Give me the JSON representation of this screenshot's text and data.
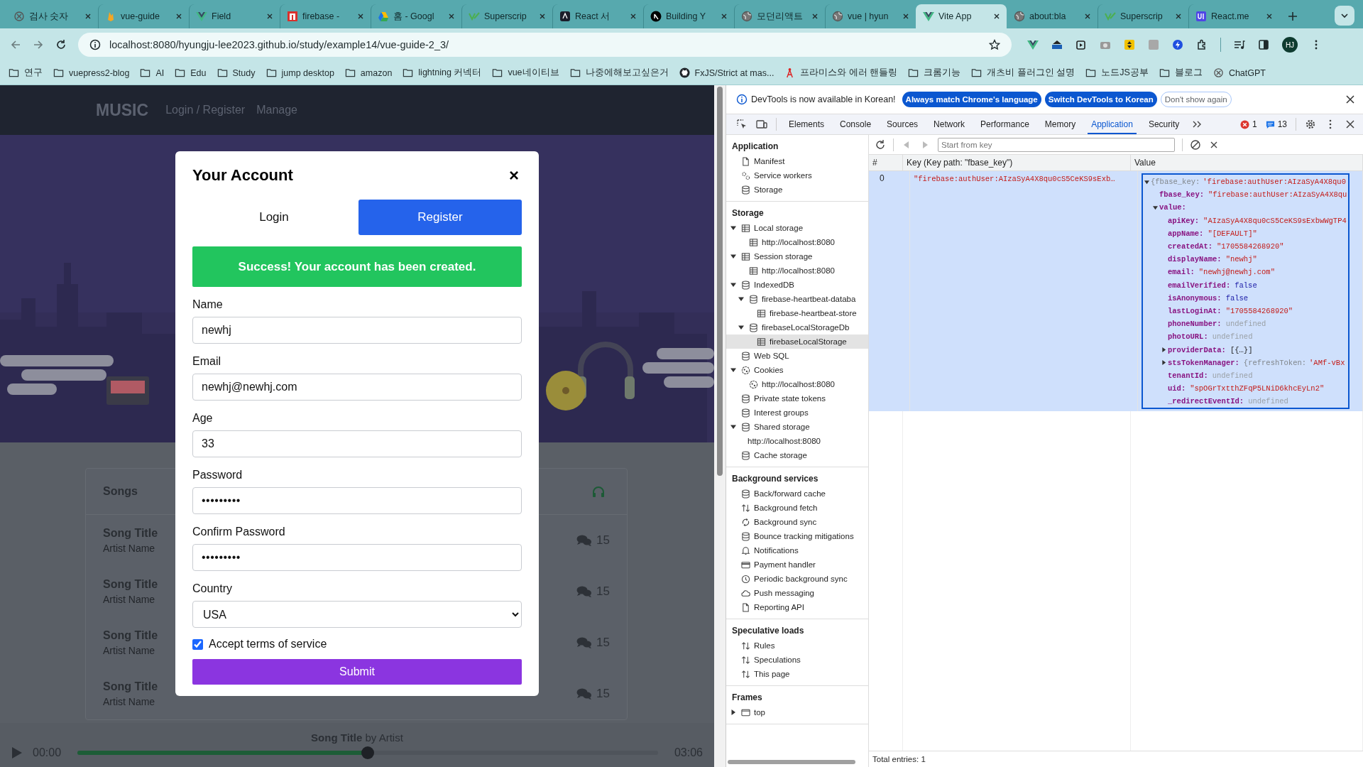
{
  "browser": {
    "tabs": [
      {
        "title": "검사 숫자",
        "kind": "knot",
        "selected": false
      },
      {
        "title": "vue-guide",
        "kind": "flame",
        "selected": false
      },
      {
        "title": "Field",
        "kind": "vue",
        "selected": false
      },
      {
        "title": "firebase -",
        "kind": "red",
        "selected": false
      },
      {
        "title": "홈 - Googl",
        "kind": "drive",
        "selected": false
      },
      {
        "title": "Superscrip",
        "kind": "vite",
        "selected": false
      },
      {
        "title": "React 서",
        "kind": "dark",
        "selected": false
      },
      {
        "title": "Building Y",
        "kind": "next",
        "selected": false
      },
      {
        "title": "모던리액트",
        "kind": "globe",
        "selected": false
      },
      {
        "title": "vue | hyun",
        "kind": "globe",
        "selected": false
      },
      {
        "title": "Vite App",
        "kind": "vue",
        "selected": true
      },
      {
        "title": "about:bla",
        "kind": "globe",
        "selected": false
      },
      {
        "title": "Superscrip",
        "kind": "vite",
        "selected": false
      },
      {
        "title": "React.me",
        "kind": "ui",
        "selected": false
      }
    ],
    "address": "localhost:8080/hyungju-lee2023.github.io/study/example14/vue-guide-2_3/",
    "profile": "HJ",
    "bookmarks": [
      {
        "label": "연구",
        "kind": "folder"
      },
      {
        "label": "vuepress2-blog",
        "kind": "folder"
      },
      {
        "label": "AI",
        "kind": "folder"
      },
      {
        "label": "Edu",
        "kind": "folder"
      },
      {
        "label": "Study",
        "kind": "folder"
      },
      {
        "label": "jump desktop",
        "kind": "folder"
      },
      {
        "label": "amazon",
        "kind": "folder"
      },
      {
        "label": "lightning 커넥터",
        "kind": "folder"
      },
      {
        "label": "vue네이티브",
        "kind": "folder"
      },
      {
        "label": "나중에해보고싶은거",
        "kind": "folder"
      },
      {
        "label": "FxJS/Strict at mas...",
        "kind": "cat"
      },
      {
        "label": "프라미스와 에러 핸들링",
        "kind": "antenna"
      },
      {
        "label": "크롬기능",
        "kind": "folder"
      },
      {
        "label": "개츠비 플러그인 설명",
        "kind": "folder"
      },
      {
        "label": "노드JS공부",
        "kind": "folder"
      },
      {
        "label": "블로그",
        "kind": "folder"
      },
      {
        "label": "ChatGPT",
        "kind": "knot"
      }
    ]
  },
  "page": {
    "logo": "MUSIC",
    "nav": [
      "Login / Register",
      "Manage"
    ],
    "songs": {
      "title": "Songs",
      "rows": [
        {
          "title": "Song Title",
          "artist": "Artist Name",
          "comments": "15"
        },
        {
          "title": "Song Title",
          "artist": "Artist Name",
          "comments": "15"
        },
        {
          "title": "Song Title",
          "artist": "Artist Name",
          "comments": "15"
        },
        {
          "title": "Song Title",
          "artist": "Artist Name",
          "comments": "15"
        }
      ]
    },
    "player": {
      "now_playing": "**Song Title** by Artist",
      "elapsed": "00:00",
      "duration": "03:06",
      "level": 0.5
    },
    "modal": {
      "title": "Your Account",
      "close": "×",
      "tabs": [
        {
          "label": "Login",
          "selected": false
        },
        {
          "label": "Register",
          "selected": true
        }
      ],
      "alert": "Success! Your account has been created.",
      "fields": [
        {
          "label": "Name",
          "value": "newhj",
          "kind": "text"
        },
        {
          "label": "Email",
          "value": "newhj@newhj.com",
          "kind": "text"
        },
        {
          "label": "Age",
          "value": "33",
          "kind": "text"
        },
        {
          "label": "Password",
          "value": "•••••••••",
          "kind": "password"
        },
        {
          "label": "Confirm Password",
          "value": "•••••••••",
          "kind": "password"
        },
        {
          "label": "Country",
          "value": "USA",
          "kind": "select"
        }
      ],
      "terms": {
        "label": "Accept terms of service",
        "checked": true
      },
      "submit": "Submit"
    }
  },
  "devtools": {
    "notice": {
      "text": "DevTools is now available in Korean!",
      "buttons": [
        {
          "label": "Always match Chrome's language",
          "kind": "primary"
        },
        {
          "label": "Switch DevTools to Korean",
          "kind": "primary"
        },
        {
          "label": "Don't show again",
          "kind": "outline"
        }
      ]
    },
    "tabs": [
      {
        "label": "Elements",
        "selected": false
      },
      {
        "label": "Console",
        "selected": false
      },
      {
        "label": "Sources",
        "selected": false
      },
      {
        "label": "Network",
        "selected": false
      },
      {
        "label": "Performance",
        "selected": false
      },
      {
        "label": "Memory",
        "selected": false
      },
      {
        "label": "Application",
        "selected": true
      },
      {
        "label": "Security",
        "selected": false
      }
    ],
    "errors": "1",
    "messages": "13",
    "sidebar": [
      {
        "heading": "Application",
        "items": [
          {
            "label": "Manifest",
            "kind": "file",
            "selected": false
          },
          {
            "label": "Service workers",
            "kind": "gears",
            "selected": false
          },
          {
            "label": "Storage",
            "kind": "database",
            "selected": false
          }
        ]
      },
      {
        "heading": "Storage",
        "items": [
          {
            "label": "Local storage",
            "kind": "table",
            "selected": false,
            "expanded": true,
            "children": [
              {
                "label": "http://localhost:8080",
                "kind": "table",
                "selected": false
              }
            ]
          },
          {
            "label": "Session storage",
            "kind": "table",
            "selected": false,
            "expanded": true,
            "children": [
              {
                "label": "http://localhost:8080",
                "kind": "table",
                "selected": false
              }
            ]
          },
          {
            "label": "IndexedDB",
            "kind": "database",
            "selected": false,
            "expanded": true,
            "children": [
              {
                "label": "firebase-heartbeat-databa",
                "kind": "database",
                "selected": false,
                "expanded": true,
                "children": [
                  {
                    "label": "firebase-heartbeat-store",
                    "kind": "table",
                    "selected": false
                  }
                ]
              },
              {
                "label": "firebaseLocalStorageDb",
                "kind": "database",
                "selected": false,
                "expanded": true,
                "children": [
                  {
                    "label": "firebaseLocalStorage",
                    "kind": "table",
                    "selected": true
                  }
                ]
              }
            ]
          },
          {
            "label": "Web SQL",
            "kind": "database",
            "selected": false
          },
          {
            "label": "Cookies",
            "kind": "cookie",
            "selected": false,
            "expanded": true,
            "children": [
              {
                "label": "http://localhost:8080",
                "kind": "cookie",
                "selected": false
              }
            ]
          },
          {
            "label": "Private state tokens",
            "kind": "database",
            "selected": false
          },
          {
            "label": "Interest groups",
            "kind": "database",
            "selected": false
          },
          {
            "label": "Shared storage",
            "kind": "database",
            "selected": false,
            "expanded": true,
            "children": [
              {
                "label": "http://localhost:8080",
                "kind": "plain",
                "selected": false
              }
            ]
          },
          {
            "label": "Cache storage",
            "kind": "database",
            "selected": false
          }
        ]
      },
      {
        "heading": "Background services",
        "items": [
          {
            "label": "Back/forward cache",
            "kind": "database",
            "selected": false
          },
          {
            "label": "Background fetch",
            "kind": "updown",
            "selected": false
          },
          {
            "label": "Background sync",
            "kind": "sync",
            "selected": false
          },
          {
            "label": "Bounce tracking mitigations",
            "kind": "database",
            "selected": false
          },
          {
            "label": "Notifications",
            "kind": "bell",
            "selected": false
          },
          {
            "label": "Payment handler",
            "kind": "card",
            "selected": false
          },
          {
            "label": "Periodic background sync",
            "kind": "clock",
            "selected": false
          },
          {
            "label": "Push messaging",
            "kind": "cloud",
            "selected": false
          },
          {
            "label": "Reporting API",
            "kind": "file",
            "selected": false
          }
        ]
      },
      {
        "heading": "Speculative loads",
        "items": [
          {
            "label": "Rules",
            "kind": "updown",
            "selected": false
          },
          {
            "label": "Speculations",
            "kind": "updown",
            "selected": false
          },
          {
            "label": "This page",
            "kind": "updown",
            "selected": false
          }
        ]
      },
      {
        "heading": "Frames",
        "items": [
          {
            "label": "top",
            "kind": "frame",
            "selected": false,
            "expanded": false
          }
        ]
      }
    ],
    "storage": {
      "placeholder": "Start from key",
      "columns": [
        "#",
        "Key (Key path: \"fbase_key\")",
        "Value"
      ],
      "rows": [
        {
          "index": "0",
          "key": "\"firebase:authUser:AIzaSyA4X8qu0cS5CeKS9sExb…",
          "selected": true,
          "value": {
            "preview_key": "{fbase_key:",
            "value": "'firebase:authUser:AIzaSyA4X8qu0",
            "kind": "string",
            "expanded": true,
            "children": [
              {
                "key": "fbase_key:",
                "value": "\"firebase:authUser:AIzaSyA4X8qu",
                "kind": "string"
              },
              {
                "key": "value:",
                "expanded": true,
                "children": [
                  {
                    "key": "apiKey:",
                    "value": "\"AIzaSyA4X8qu0cS5CeKS9sExbwWgTP4",
                    "kind": "string"
                  },
                  {
                    "key": "appName:",
                    "value": "\"[DEFAULT]\"",
                    "kind": "string"
                  },
                  {
                    "key": "createdAt:",
                    "value": "\"1705584268920\"",
                    "kind": "string"
                  },
                  {
                    "key": "displayName:",
                    "value": "\"newhj\"",
                    "kind": "string"
                  },
                  {
                    "key": "email:",
                    "value": "\"newhj@newhj.com\"",
                    "kind": "string"
                  },
                  {
                    "key": "emailVerified:",
                    "value": "false",
                    "kind": "boolean"
                  },
                  {
                    "key": "isAnonymous:",
                    "value": "false",
                    "kind": "boolean"
                  },
                  {
                    "key": "lastLoginAt:",
                    "value": "\"1705584268920\"",
                    "kind": "string"
                  },
                  {
                    "key": "phoneNumber:",
                    "value": "undefined",
                    "kind": "undefined"
                  },
                  {
                    "key": "photoURL:",
                    "value": "undefined",
                    "kind": "undefined"
                  },
                  {
                    "key": "providerData:",
                    "value": "[{…}]",
                    "kind": "object",
                    "expanded": false
                  },
                  {
                    "key": "stsTokenManager:",
                    "preview_key": "{refreshToken:",
                    "value": "'AMf-vBx",
                    "kind": "string",
                    "expanded": false
                  },
                  {
                    "key": "tenantId:",
                    "value": "undefined",
                    "kind": "undefined"
                  },
                  {
                    "key": "uid:",
                    "value": "\"spOGrTxtthZFqP5LNiD6khcEyLn2\"",
                    "kind": "string"
                  },
                  {
                    "key": "_redirectEventId:",
                    "value": "undefined",
                    "kind": "undefined"
                  }
                ]
              }
            ]
          }
        }
      ],
      "footer": "Total entries: 1"
    }
  }
}
